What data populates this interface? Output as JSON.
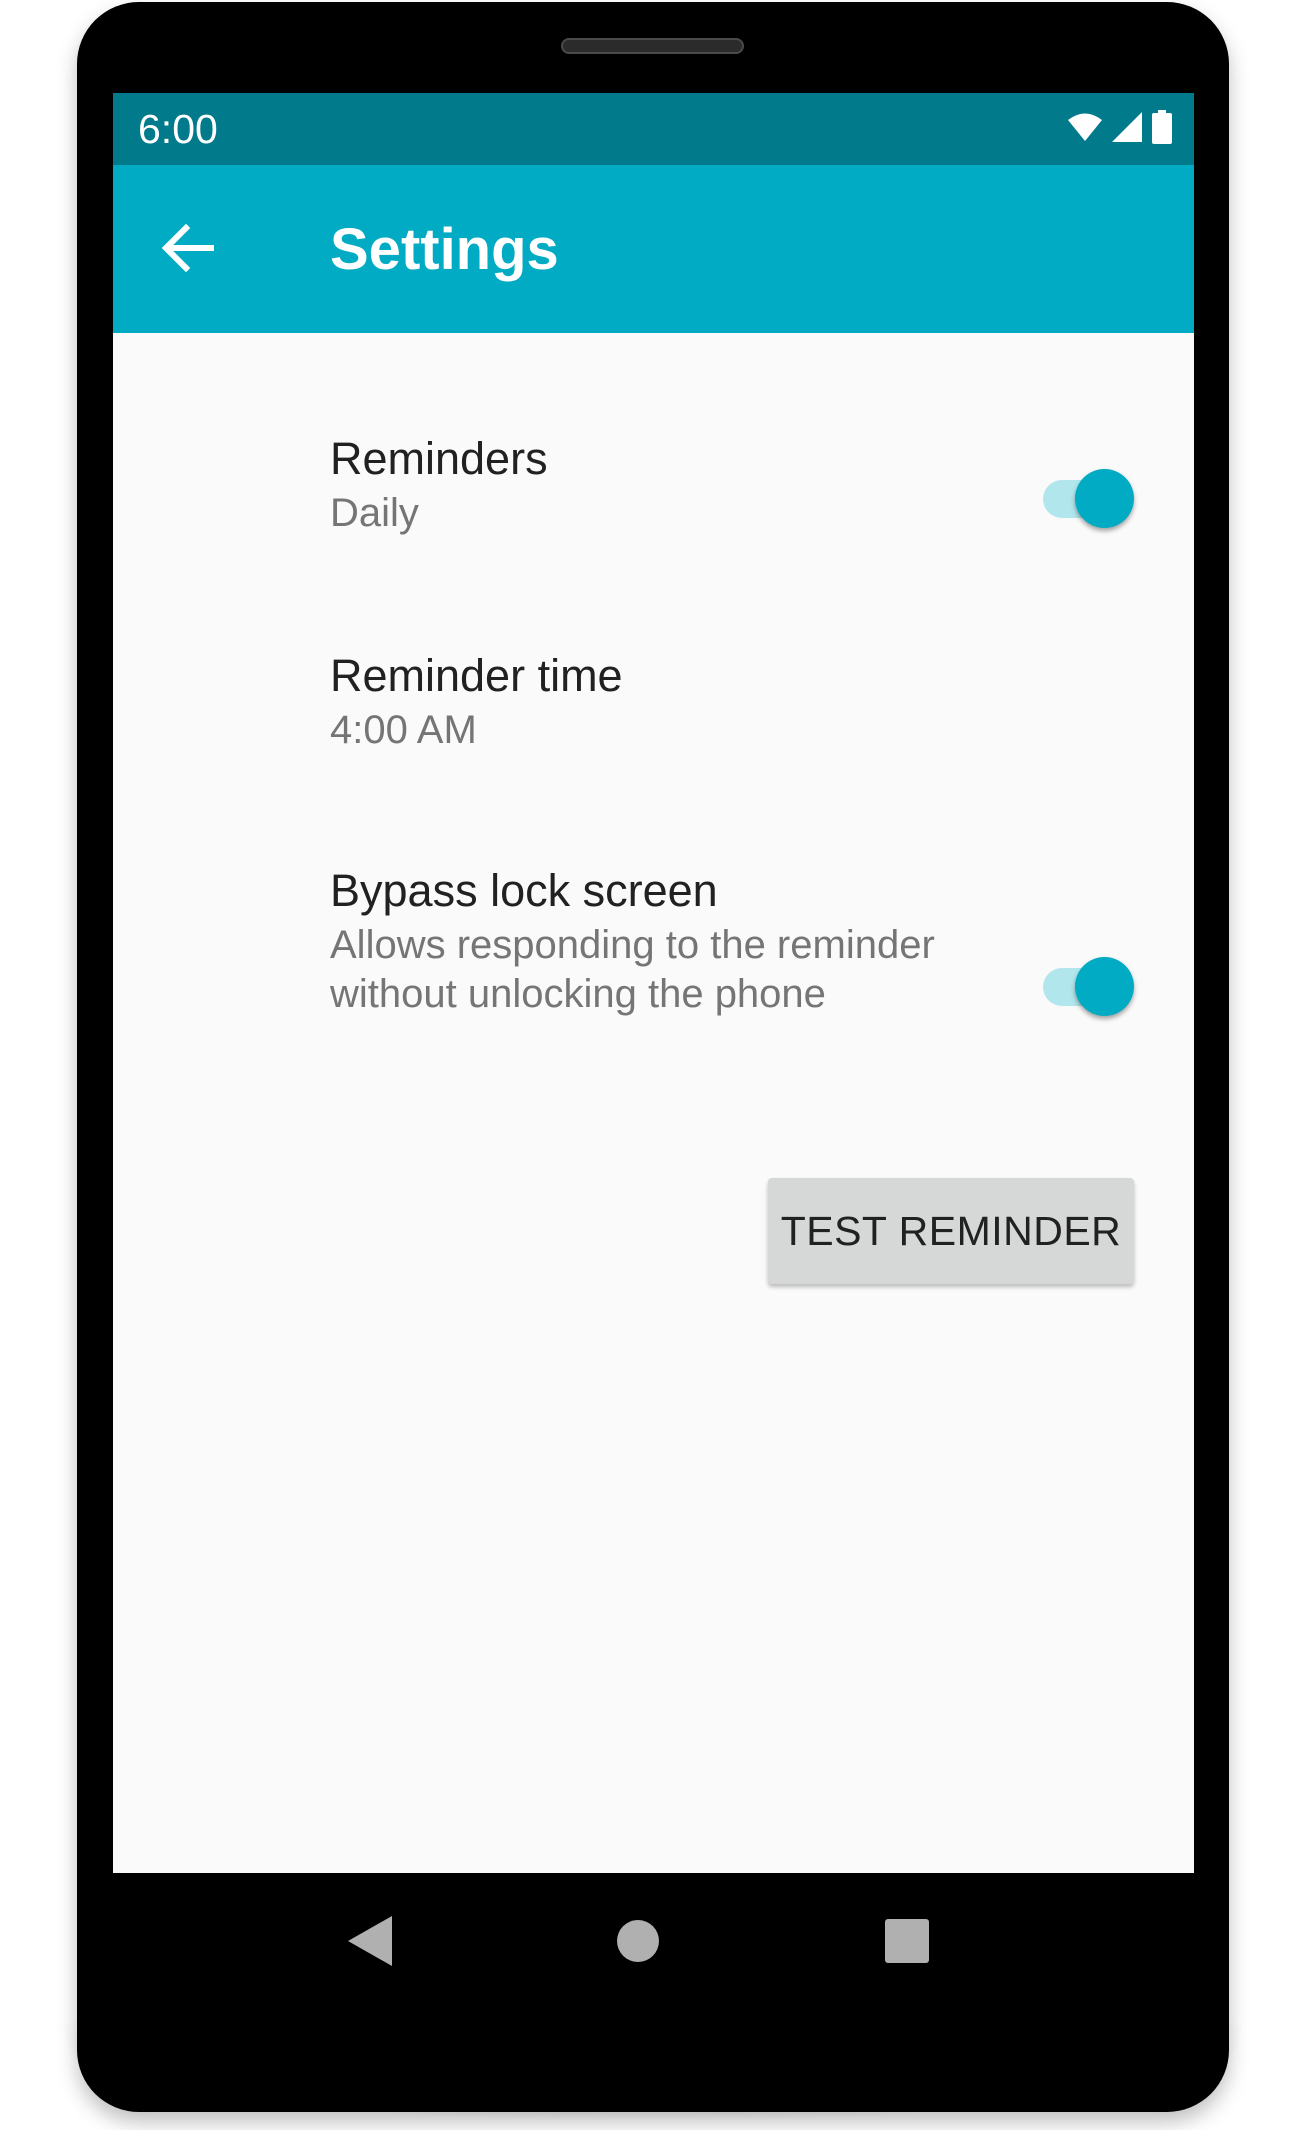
{
  "status_bar": {
    "time": "6:00",
    "icons": [
      "wifi-icon",
      "cellular-signal-icon",
      "battery-icon"
    ]
  },
  "app_bar": {
    "back_icon": "arrow-back-icon",
    "title": "Settings"
  },
  "preferences": [
    {
      "title": "Reminders",
      "summary": "Daily",
      "switch_on": true
    },
    {
      "title": "Reminder time",
      "summary": "4:00 AM"
    },
    {
      "title": "Bypass lock screen",
      "summary": "Allows responding to the reminder without unlocking the phone",
      "switch_on": true
    }
  ],
  "actions": {
    "test_reminder_label": "TEST REMINDER"
  },
  "navigation": {
    "icons": [
      "back-triangle-icon",
      "home-circle-icon",
      "recents-square-icon"
    ]
  },
  "colors": {
    "status_bar": "#017a8c",
    "app_bar": "#00abc3",
    "accent": "#00abc3",
    "switch_track": "#b2e6ed",
    "background": "#fafafa",
    "button": "#d6d7d7"
  }
}
